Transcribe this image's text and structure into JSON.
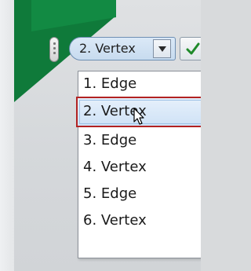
{
  "toolbar": {
    "combo_value": "2. Vertex",
    "icons": {
      "grip": "grip-handle-icon",
      "dropdown": "chevron-down-icon",
      "confirm": "checkmark-icon"
    }
  },
  "dropdown": {
    "options": [
      "1. Edge",
      "2. Vertex",
      "3. Edge",
      "4. Vertex",
      "5. Edge",
      "6. Vertex"
    ],
    "selected_index": 1
  },
  "colors": {
    "green": "#0f7a3a",
    "highlight_border": "#b22222",
    "checkmark": "#1f8a2a"
  }
}
